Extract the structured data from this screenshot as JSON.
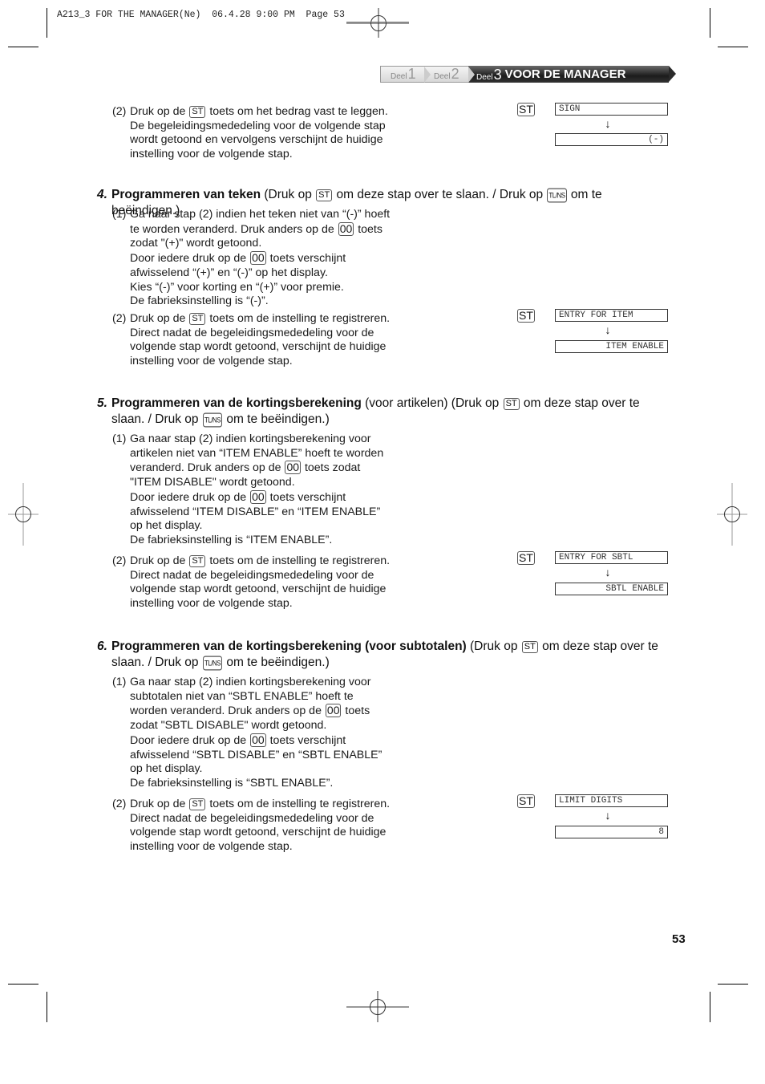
{
  "print_header": "A213_3 FOR THE MANAGER(Ne)  06.4.28 9:00 PM  Page 53",
  "banner": {
    "crumbs": [
      {
        "prefix": "Deel",
        "number": "1"
      },
      {
        "prefix": "Deel",
        "number": "2"
      },
      {
        "prefix": "Deel",
        "number": "3",
        "title": "VOOR DE MANAGER"
      }
    ],
    "active_color": "#1c1c1c"
  },
  "keys": {
    "st": "ST",
    "double_zero": "00",
    "tl_ns": "TL/NS"
  },
  "section_prev": {
    "step2": {
      "label": "(2)",
      "lines": [
        [
          "Druk op de ",
          "key:st",
          " toets om het bedrag vast te leggen."
        ],
        "De begeleidingsmededeling voor de volgende stap",
        "wordt getoond en vervolgens verschijnt de huidige",
        "instelling voor de volgende stap."
      ],
      "display_top": "SIGN",
      "display_bottom": "(-)"
    }
  },
  "sections": [
    {
      "number": "4.",
      "title_bold": "Programmeren van teken",
      "title_rest": " (Druk op ",
      "skip_text": " om deze stap over te slaan. / Druk op ",
      "end_text": " om te beëindigen.)",
      "step1": {
        "label": "(1)",
        "lines": [
          "Ga naar stap (2) indien het teken niet van “(-)” hoeft",
          "te worden veranderd. Druk anders op de [00] toets",
          "zodat \"(+)\" wordt getoond.",
          "Door iedere druk op de [00] toets verschijnt",
          "afwisselend “(+)” en “(-)” op het display.",
          "Kies “(-)” voor korting en “(+)” voor premie.",
          "De fabrieksinstelling is “(-)”."
        ]
      },
      "step2": {
        "label": "(2)",
        "lines": [
          "Druk op de [ST] toets om de instelling te registreren.",
          "Direct nadat de begeleidingsmededeling voor de",
          "volgende stap wordt getoond, verschijnt de huidige",
          "instelling voor de volgende stap."
        ],
        "display_top": "ENTRY FOR ITEM",
        "display_bottom": "ITEM ENABLE"
      }
    },
    {
      "number": "5.",
      "title_bold": "Programmeren van de kortingsberekening",
      "title_rest": " (voor artikelen) (Druk op ",
      "skip_text": " om deze stap over te slaan. / Druk op ",
      "end_text": " om te beëindigen.)",
      "step1": {
        "label": "(1)",
        "lines": [
          "Ga naar stap (2) indien kortingsberekening voor",
          "artikelen niet van “ITEM ENABLE” hoeft te worden",
          "veranderd. Druk anders op de [00] toets zodat",
          "\"ITEM DISABLE\" wordt getoond.",
          "Door iedere druk op de [00] toets verschijnt",
          "afwisselend “ITEM DISABLE” en “ITEM ENABLE”",
          "op het display.",
          "De fabrieksinstelling is “ITEM ENABLE”."
        ]
      },
      "step2": {
        "label": "(2)",
        "lines": [
          "Druk op de [ST] toets om de instelling te registreren.",
          "Direct nadat de begeleidingsmededeling voor de",
          "volgende stap wordt getoond, verschijnt de huidige",
          "instelling voor de volgende stap."
        ],
        "display_top": "ENTRY FOR SBTL",
        "display_bottom": "SBTL ENABLE"
      }
    },
    {
      "number": "6.",
      "title_bold": "Programmeren van de kortingsberekening (voor subtotalen)",
      "title_rest": " (Druk op ",
      "skip_text": " om deze stap over te slaan. / Druk op ",
      "end_text": " om te beëindigen.)",
      "step1": {
        "label": "(1)",
        "lines": [
          "Ga naar stap (2) indien kortingsberekening voor",
          "subtotalen niet van “SBTL ENABLE” hoeft te",
          "worden veranderd. Druk anders op de [00] toets",
          "zodat \"SBTL DISABLE\" wordt getoond.",
          "Door iedere druk op de [00] toets verschijnt",
          "afwisselend “SBTL DISABLE” en “SBTL ENABLE”",
          "op het display.",
          "De fabrieksinstelling is “SBTL ENABLE”."
        ]
      },
      "step2": {
        "label": "(2)",
        "lines": [
          "Druk op de [ST] toets om de instelling te registreren.",
          "Direct nadat de begeleidingsmededeling voor de",
          "volgende stap wordt getoond, verschijnt de huidige",
          "instelling voor de volgende stap."
        ],
        "display_top": "LIMIT DIGITS",
        "display_bottom": "8"
      }
    }
  ],
  "arrow_glyph": "↓",
  "page_number": "53"
}
